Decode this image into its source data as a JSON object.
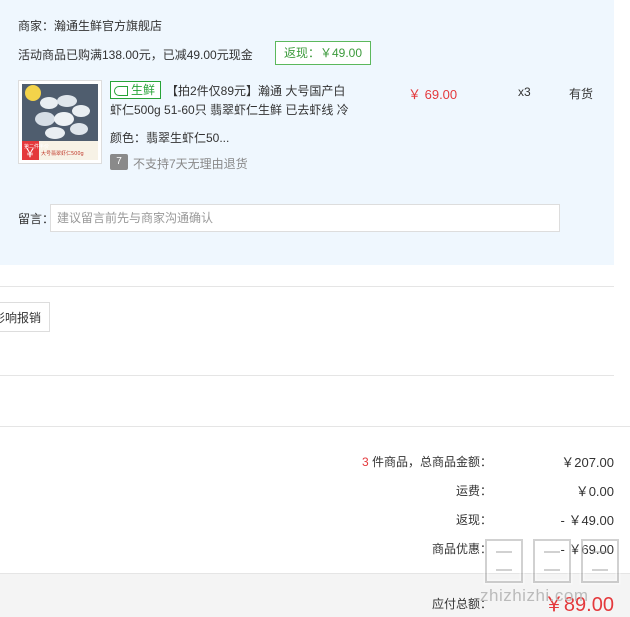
{
  "store": {
    "label": "商家：",
    "name": "瀚通生鲜官方旗舰店"
  },
  "promotion": {
    "text": "活动商品已购满138.00元，已减49.00元现金",
    "cashback_badge": "返现：￥49.00"
  },
  "item": {
    "fresh_tag": "生鲜",
    "title_line1": "【拍2件仅89元】瀚通 大号国产白",
    "title_line2": "虾仁500g 51-60只 翡翠虾仁生鲜 已去虾线 冷",
    "variant": "颜色：翡翠生虾仁50...",
    "return_policy_icon": "7",
    "return_policy": "不支持7天无理由退货",
    "price": "￥ 69.00",
    "quantity": "x3",
    "stock": "有货",
    "thumbnail": {
      "badge_text": "第二件半价",
      "promo_text": "大号翡翠虾仁500g",
      "price_symbol": "￥"
    }
  },
  "message": {
    "label": "留言：",
    "placeholder": "建议留言前先与商家沟通确认"
  },
  "invoice_button": "影响报销",
  "summary": {
    "items_count": "3",
    "items_label": " 件商品，总商品金额：",
    "items_amount": "￥207.00",
    "shipping_label": "运费：",
    "shipping_amount": "￥0.00",
    "cashback_label": "返现：",
    "cashback_amount": "- ￥49.00",
    "discount_label": "商品优惠：",
    "discount_amount": "- ￥69.00",
    "total_label": "应付总额：",
    "total_amount": "￥89.00"
  },
  "watermark": {
    "text": "zhizhizhi.com"
  },
  "colors": {
    "panel_bg": "#eff7fe",
    "accent_red": "#e4393c",
    "fresh_green": "#27a337",
    "badge_green": "#5cb85c"
  }
}
